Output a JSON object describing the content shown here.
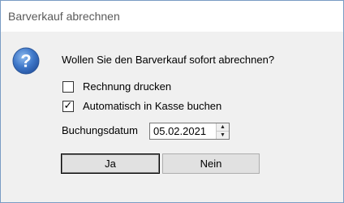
{
  "dialog": {
    "title": "Barverkauf abrechnen",
    "icon": "question-icon",
    "question": "Wollen Sie den Barverkauf sofort abrechnen?"
  },
  "options": {
    "print_invoice": {
      "label": "Rechnung drucken",
      "checked": false
    },
    "auto_post": {
      "label": "Automatisch in Kasse buchen",
      "checked": true
    }
  },
  "booking_date": {
    "label": "Buchungsdatum",
    "value": "05.02.2021"
  },
  "buttons": {
    "yes": {
      "accel": "J",
      "rest": "a"
    },
    "no": {
      "accel": "N",
      "rest": "ein"
    }
  }
}
